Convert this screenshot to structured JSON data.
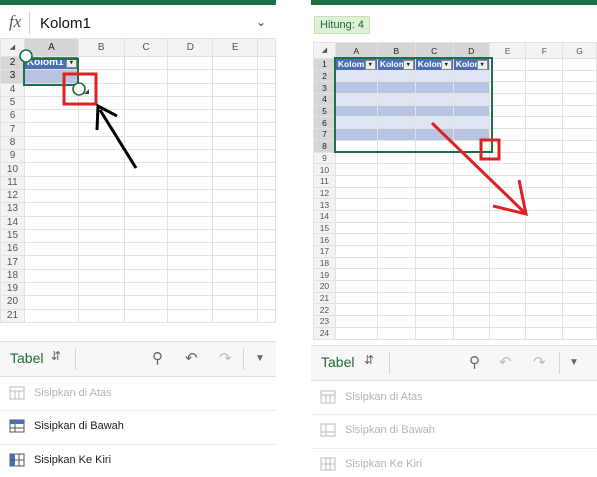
{
  "left": {
    "formula": {
      "fx_label": "fx",
      "value": "Kolom1"
    },
    "col_headers": [
      "A",
      "B",
      "C",
      "D",
      "E"
    ],
    "rows": [
      "2",
      "3",
      "4",
      "5",
      "6",
      "7",
      "8",
      "9",
      "10",
      "11",
      "12",
      "13",
      "14",
      "15",
      "16",
      "17",
      "18",
      "19",
      "20",
      "21"
    ],
    "table_header": "Kolom1",
    "toolbar": {
      "label": "Tabel"
    },
    "menu": [
      {
        "label": "Sisipkan di Atas",
        "enabled": false,
        "icon": "insert-above-icon"
      },
      {
        "label": "Sisipkan di Bawah",
        "enabled": true,
        "icon": "insert-below-icon"
      },
      {
        "label": "Sisipkan Ke Kiri",
        "enabled": true,
        "icon": "insert-left-icon"
      }
    ]
  },
  "right": {
    "count_badge": "Hitung: 4",
    "col_headers": [
      "A",
      "B",
      "C",
      "D",
      "E",
      "F",
      "G"
    ],
    "rows": [
      "1",
      "2",
      "3",
      "4",
      "5",
      "6",
      "7",
      "8",
      "9",
      "10",
      "11",
      "12",
      "13",
      "14",
      "15",
      "16",
      "17",
      "18",
      "19",
      "20",
      "21",
      "22",
      "23",
      "24"
    ],
    "table_headers": [
      "Kolom1",
      "Kolom2",
      "Kolom3",
      "Kolom4"
    ],
    "toolbar": {
      "label": "Tabel"
    },
    "menu": [
      {
        "label": "Sisipkan di Atas",
        "enabled": false,
        "icon": "insert-above-icon"
      },
      {
        "label": "Sisipkan di Bawah",
        "enabled": false,
        "icon": "insert-below-icon"
      },
      {
        "label": "Sisipkan Ke Kiri",
        "enabled": false,
        "icon": "insert-left-icon"
      }
    ]
  },
  "colors": {
    "excel_green": "#1e7145",
    "table_header_blue": "#4a6fb5",
    "band_dark": "#b7c5e3",
    "band_light": "#dfe5f2",
    "highlight_red": "#e02020",
    "arrow_black": "#000000"
  },
  "icons": {
    "select_all": "select-all-triangle-icon",
    "filter": "filter-dropdown-icon",
    "toolbar": [
      "chevron-updown-icon",
      "lightbulb-icon",
      "undo-icon",
      "redo-icon",
      "chevron-down-icon"
    ]
  }
}
